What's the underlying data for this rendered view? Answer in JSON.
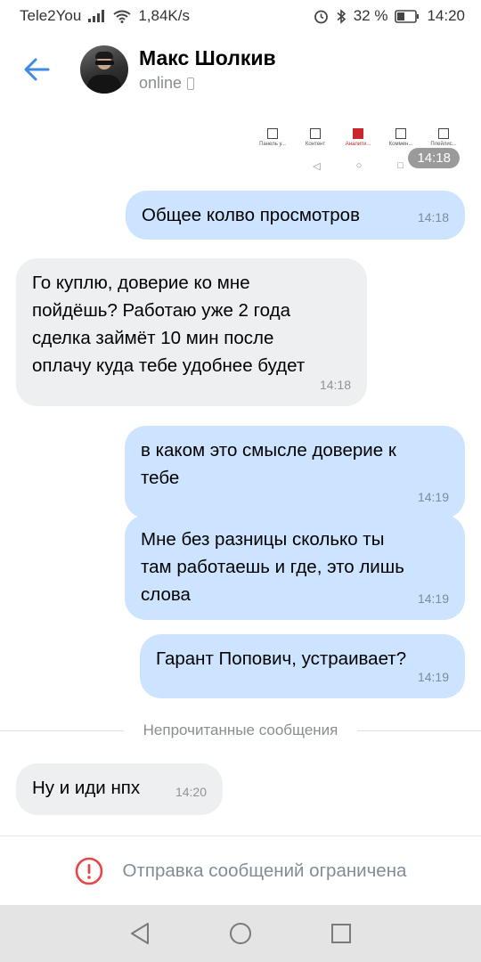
{
  "status_bar": {
    "carrier": "Tele2You",
    "speed": "1,84K/s",
    "battery": "32 %",
    "time": "14:20",
    "icons": [
      "signal-icon",
      "wifi-icon",
      "alarm-icon",
      "bluetooth-icon",
      "battery-icon"
    ]
  },
  "header": {
    "contact_name": "Макс Шолкив",
    "status": "online",
    "back_icon": "back-arrow-icon",
    "accent": "#3f8ae0"
  },
  "image_message": {
    "toolbar": [
      "Панель у...",
      "Контент",
      "Аналити...",
      "Коммен...",
      "Плейлис..."
    ],
    "active_index": 2,
    "time": "14:18"
  },
  "messages": [
    {
      "direction": "out",
      "text": "Общее колво просмотров",
      "time": "14:18"
    },
    {
      "direction": "in",
      "text": "Го куплю,  доверие ко мне\nпойдёшь?  Работаю уже 2 года\nсделка займёт 10 мин после\nоплачу куда тебе удобнее будет",
      "time": "14:18"
    },
    {
      "direction": "out",
      "text": "в каком это смысле доверие к\nтебе",
      "time": "14:19"
    },
    {
      "direction": "out",
      "text": "Мне без разницы сколько ты\nтам работаешь и где, это лишь\nслова",
      "time": "14:19"
    },
    {
      "direction": "out",
      "text": "Гарант Попович, устраивает?",
      "time": "14:19"
    },
    {
      "direction": "in",
      "text": "Ну и иди нпх",
      "time": "14:20"
    }
  ],
  "unread_divider": "Непрочитанные сообщения",
  "restriction": {
    "text": "Отправка сообщений ограничена",
    "icon": "warning-circle-icon",
    "icon_color": "#e64646"
  },
  "colors": {
    "bubble_out": "#cce4ff",
    "bubble_in": "#eeeff1",
    "secondary_text": "#818c99"
  },
  "nav_bar": {
    "buttons": [
      "back-triangle-icon",
      "home-circle-icon",
      "recents-square-icon"
    ]
  }
}
